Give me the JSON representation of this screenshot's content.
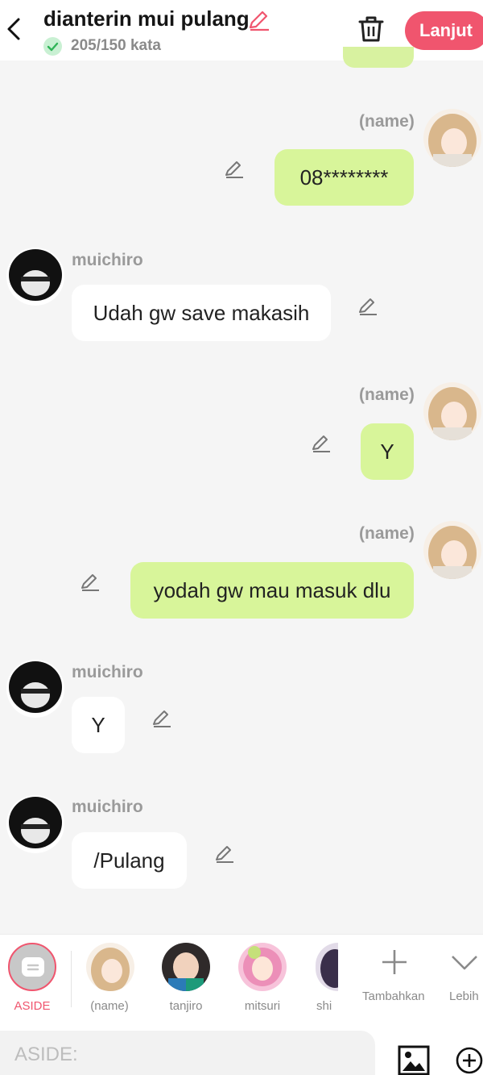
{
  "header": {
    "title": "dianterin mui pulang",
    "subtitle": "205/150 kata",
    "next_label": "Lanjut"
  },
  "messages": [
    {
      "speaker": "(name)",
      "text": "08********",
      "side": "right"
    },
    {
      "speaker": "muichiro",
      "text": "Udah gw save makasih",
      "side": "left"
    },
    {
      "speaker": "(name)",
      "text": "Y",
      "side": "right"
    },
    {
      "speaker": "(name)",
      "text": "yodah gw mau masuk dlu",
      "side": "right"
    },
    {
      "speaker": "muichiro",
      "text": "Y",
      "side": "left"
    },
    {
      "speaker": "muichiro",
      "text": "/Pulang",
      "side": "left"
    }
  ],
  "characters": {
    "aside_label": "ASIDE",
    "items": [
      "(name)",
      "tanjiro",
      "mitsuri",
      "shi"
    ],
    "add_label": "Tambahkan",
    "more_label": "Lebih"
  },
  "input": {
    "placeholder": "ASIDE:"
  },
  "colors": {
    "accent": "#f0556e",
    "my_bubble": "#d8f59a",
    "their_bubble": "#ffffff",
    "background": "#f5f5f5"
  }
}
